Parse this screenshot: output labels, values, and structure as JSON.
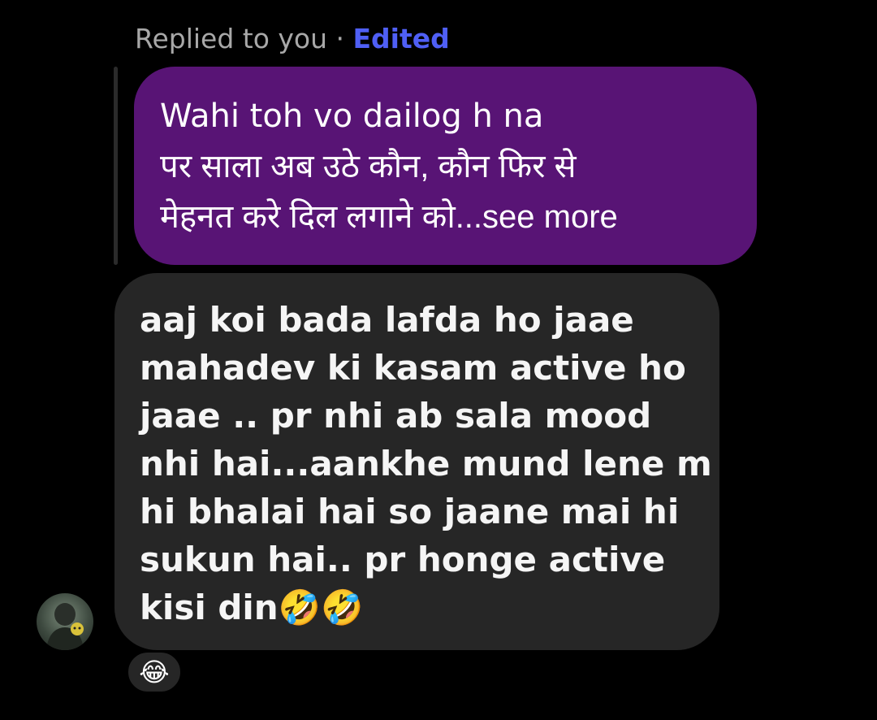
{
  "reply_header": {
    "replied_to": "Replied to you · ",
    "edited": "Edited"
  },
  "replied_message": {
    "lines": [
      "Wahi toh vo dailog h na",
      "पर साला अब उठे कौन, कौन फिर से",
      "मेहनत करे दिल लगाने को...see more"
    ]
  },
  "message": {
    "lines": [
      "aaj koi bada lafda ho jaae",
      "mahadev ki kasam active ho",
      "jaae .. pr nhi ab sala mood",
      "nhi hai...aankhe mund lene m",
      "hi bhalai hai so jaane mai hi",
      "sukun hai.. pr honge active",
      "kisi din"
    ],
    "trailing_emojis": "🤣🤣"
  },
  "reaction": {
    "emoji": "😂"
  },
  "avatar": {
    "icon": "user-avatar"
  },
  "colors": {
    "background": "#000000",
    "replied_bubble": "#581475",
    "message_bubble": "#262626",
    "edited_label": "#4f5ff5",
    "header_text": "#a8a8a8"
  }
}
